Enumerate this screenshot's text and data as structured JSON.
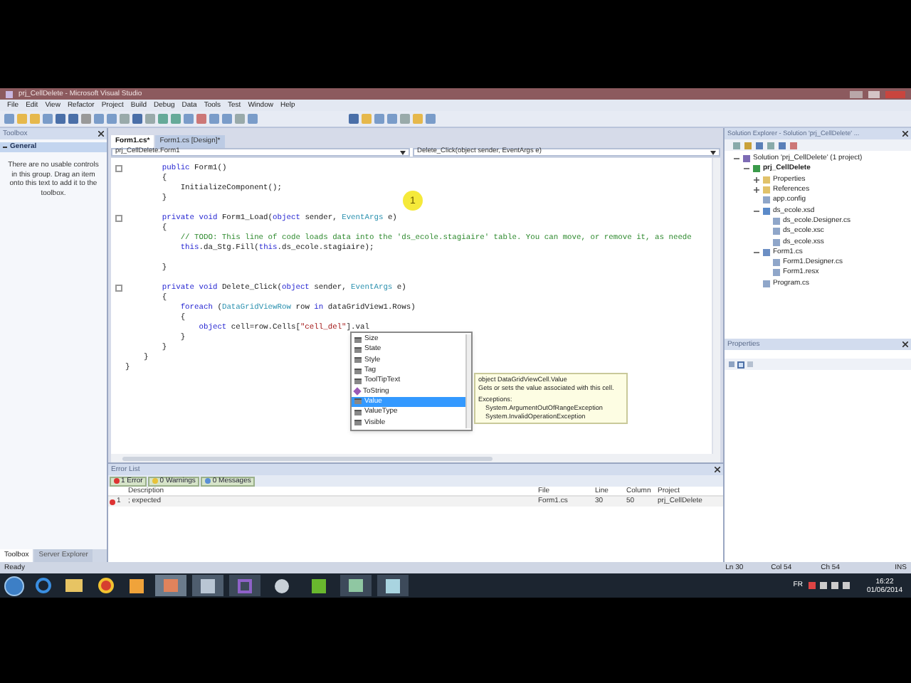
{
  "window": {
    "title": "prj_CellDelete - Microsoft Visual Studio"
  },
  "menu": [
    "File",
    "Edit",
    "View",
    "Refactor",
    "Project",
    "Build",
    "Debug",
    "Data",
    "Tools",
    "Test",
    "Window",
    "Help"
  ],
  "toolbox": {
    "title": "Toolbox",
    "group": "General",
    "message": "There are no usable controls in this group. Drag an item onto this text to add it to the toolbox."
  },
  "side_tabs": [
    {
      "label": "Toolbox",
      "selected": true
    },
    {
      "label": "Server Explorer",
      "selected": false
    }
  ],
  "editor": {
    "tabs": [
      {
        "label": "Form1.cs*",
        "selected": true
      },
      {
        "label": "Form1.cs [Design]*",
        "selected": false
      }
    ],
    "type_dropdown": "prj_CellDelete.Form1",
    "member_dropdown": "Delete_Click(object sender, EventArgs e)",
    "lines": [
      {
        "outline": true,
        "tokens": [
          {
            "kind": "keyword",
            "text": "        public"
          },
          {
            "kind": "plain",
            "text": " Form1()"
          }
        ]
      },
      {
        "outline": false,
        "tokens": [
          {
            "kind": "plain",
            "text": "        {"
          }
        ]
      },
      {
        "outline": false,
        "tokens": [
          {
            "kind": "plain",
            "text": "            InitializeComponent();"
          }
        ]
      },
      {
        "outline": false,
        "tokens": [
          {
            "kind": "plain",
            "text": "        }"
          }
        ]
      },
      {
        "outline": false
      },
      {
        "outline": true,
        "tokens": [
          {
            "kind": "keyword",
            "text": "        private void"
          },
          {
            "kind": "plain",
            "text": " Form1_Load("
          },
          {
            "kind": "keyword",
            "text": "object"
          },
          {
            "kind": "plain",
            "text": " sender, "
          },
          {
            "kind": "type",
            "text": "EventArgs"
          },
          {
            "kind": "plain",
            "text": " e)"
          }
        ]
      },
      {
        "outline": false,
        "tokens": [
          {
            "kind": "plain",
            "text": "        {"
          }
        ]
      },
      {
        "outline": false,
        "tokens": [
          {
            "kind": "comment",
            "text": "            // TODO: This line of code loads data into the 'ds_ecole.stagiaire' table. You can move, or remove it, as neede"
          }
        ]
      },
      {
        "outline": false,
        "tokens": [
          {
            "kind": "keyword",
            "text": "            this"
          },
          {
            "kind": "plain",
            "text": ".da_Stg.Fill("
          },
          {
            "kind": "keyword",
            "text": "this"
          },
          {
            "kind": "plain",
            "text": ".ds_ecole.stagiaire);"
          }
        ]
      },
      {
        "outline": false
      },
      {
        "outline": false,
        "tokens": [
          {
            "kind": "plain",
            "text": "        }"
          }
        ]
      },
      {
        "outline": false
      },
      {
        "outline": true,
        "tokens": [
          {
            "kind": "keyword",
            "text": "        private void"
          },
          {
            "kind": "plain",
            "text": " Delete_Click("
          },
          {
            "kind": "keyword",
            "text": "object"
          },
          {
            "kind": "plain",
            "text": " sender, "
          },
          {
            "kind": "type",
            "text": "EventArgs"
          },
          {
            "kind": "plain",
            "text": " e)"
          }
        ]
      },
      {
        "outline": false,
        "tokens": [
          {
            "kind": "plain",
            "text": "        {"
          }
        ]
      },
      {
        "outline": false,
        "tokens": [
          {
            "kind": "keyword",
            "text": "            foreach"
          },
          {
            "kind": "plain",
            "text": " ("
          },
          {
            "kind": "type",
            "text": "DataGridViewRow"
          },
          {
            "kind": "plain",
            "text": " row "
          },
          {
            "kind": "keyword",
            "text": "in"
          },
          {
            "kind": "plain",
            "text": " dataGridView1.Rows)"
          }
        ]
      },
      {
        "outline": false,
        "tokens": [
          {
            "kind": "plain",
            "text": "            {"
          }
        ]
      },
      {
        "outline": false,
        "tokens": [
          {
            "kind": "keyword",
            "text": "                object"
          },
          {
            "kind": "plain",
            "text": " cell=row.Cells["
          },
          {
            "kind": "string",
            "text": "\"cell_del\""
          },
          {
            "kind": "plain",
            "text": "].val"
          }
        ]
      },
      {
        "outline": false,
        "tokens": [
          {
            "kind": "plain",
            "text": "            }"
          }
        ]
      },
      {
        "outline": false,
        "tokens": [
          {
            "kind": "plain",
            "text": "        }"
          }
        ]
      },
      {
        "outline": false,
        "tokens": [
          {
            "kind": "plain",
            "text": "    }"
          }
        ]
      },
      {
        "outline": false,
        "tokens": [
          {
            "kind": "plain",
            "text": "}"
          }
        ]
      }
    ],
    "click_marker": "1",
    "completion": [
      {
        "label": "Size",
        "kind": "property",
        "selected": false
      },
      {
        "label": "State",
        "kind": "property",
        "selected": false
      },
      {
        "label": "Style",
        "kind": "property",
        "selected": false
      },
      {
        "label": "Tag",
        "kind": "property",
        "selected": false
      },
      {
        "label": "ToolTipText",
        "kind": "property",
        "selected": false
      },
      {
        "label": "ToString",
        "kind": "method",
        "selected": false
      },
      {
        "label": "Value",
        "kind": "property",
        "selected": true
      },
      {
        "label": "ValueType",
        "kind": "property",
        "selected": false
      },
      {
        "label": "Visible",
        "kind": "property",
        "selected": false
      }
    ],
    "tooltip": {
      "signature": "object DataGridViewCell.Value",
      "summary": "Gets or sets the value associated with this cell.",
      "exceptions_title": "Exceptions:",
      "exceptions": [
        "System.ArgumentOutOfRangeException",
        "System.InvalidOperationException"
      ]
    }
  },
  "error_list": {
    "title": "Error List",
    "filters": [
      {
        "kind": "error",
        "label": "1 Error"
      },
      {
        "kind": "warning",
        "label": "0 Warnings"
      },
      {
        "kind": "message",
        "label": "0 Messages"
      }
    ],
    "columns": [
      "Description",
      "File",
      "Line",
      "Column",
      "Project"
    ],
    "rows": [
      {
        "kind": "error",
        "number": "1",
        "description": "; expected",
        "file": "Form1.cs",
        "line": "30",
        "column": "50",
        "project": "prj_CellDelete"
      }
    ]
  },
  "solution_explorer": {
    "title": "Solution Explorer - Solution 'prj_CellDelete' ...",
    "tree": [
      {
        "label": "Solution 'prj_CellDelete' (1 project)",
        "kind": "solution",
        "expanded": true,
        "children": [
          {
            "label": "prj_CellDelete",
            "kind": "project",
            "expanded": true,
            "children": [
              {
                "label": "Properties",
                "kind": "folder",
                "expanded": false
              },
              {
                "label": "References",
                "kind": "folder",
                "expanded": false
              },
              {
                "label": "app.config",
                "kind": "file"
              },
              {
                "label": "ds_ecole.xsd",
                "kind": "dataset",
                "expanded": true,
                "children": [
                  {
                    "label": "ds_ecole.Designer.cs",
                    "kind": "file"
                  },
                  {
                    "label": "ds_ecole.xsc",
                    "kind": "file"
                  },
                  {
                    "label": "ds_ecole.xss",
                    "kind": "file"
                  }
                ]
              },
              {
                "label": "Form1.cs",
                "kind": "form",
                "expanded": true,
                "children": [
                  {
                    "label": "Form1.Designer.cs",
                    "kind": "file"
                  },
                  {
                    "label": "Form1.resx",
                    "kind": "file"
                  }
                ]
              },
              {
                "label": "Program.cs",
                "kind": "file"
              }
            ]
          }
        ]
      }
    ]
  },
  "properties": {
    "title": "Properties"
  },
  "status_bar": {
    "text": "Ready",
    "line": "Ln 30",
    "column": "Col 54",
    "char": "Ch 54",
    "mode": "INS"
  },
  "taskbar": {
    "language": "FR",
    "time": "16:22",
    "date": "01/06/2014"
  }
}
